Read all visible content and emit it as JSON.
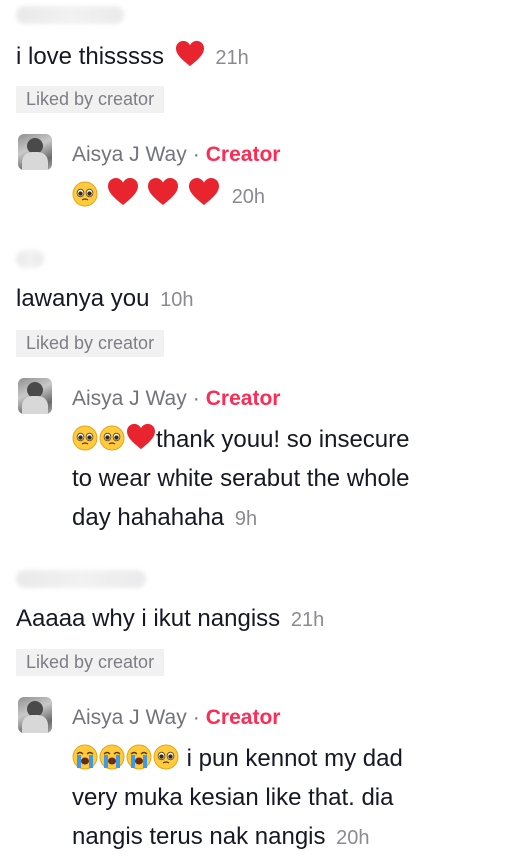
{
  "comments": [
    {
      "text": "i love thisssss",
      "emoji": "heart",
      "time": "21h",
      "liked_by_creator": "Liked by creator",
      "reply": {
        "author": "Aisya J Way",
        "separator": "·",
        "role": "Creator",
        "lines": [
          ""
        ],
        "emoji_prefix": [
          "pleading",
          "heart",
          "heart",
          "heart"
        ],
        "time": "20h"
      }
    },
    {
      "text": "lawanya you",
      "time": "10h",
      "liked_by_creator": "Liked by creator",
      "reply": {
        "author": "Aisya J Way",
        "separator": "·",
        "role": "Creator",
        "emoji_prefix": [
          "pleading",
          "pleading",
          "heart"
        ],
        "lines": [
          "thank youu! so insecure",
          "to wear white serabut the whole",
          "day hahahaha"
        ],
        "time": "9h"
      }
    },
    {
      "text": "Aaaaa why i ikut nangiss",
      "time": "21h",
      "liked_by_creator": "Liked by creator",
      "reply": {
        "author": "Aisya J Way",
        "separator": "·",
        "role": "Creator",
        "emoji_prefix": [
          "crying",
          "crying",
          "crying",
          "pleading"
        ],
        "lines": [
          " i pun kennot my dad",
          "very muka kesian like that. dia",
          "nangis terus nak nangis"
        ],
        "time": "20h"
      }
    }
  ],
  "colors": {
    "creator": "#fe2c55",
    "heart": "#e8242f",
    "muted": "#8a8b91",
    "badge_bg": "#f1f1f2"
  }
}
